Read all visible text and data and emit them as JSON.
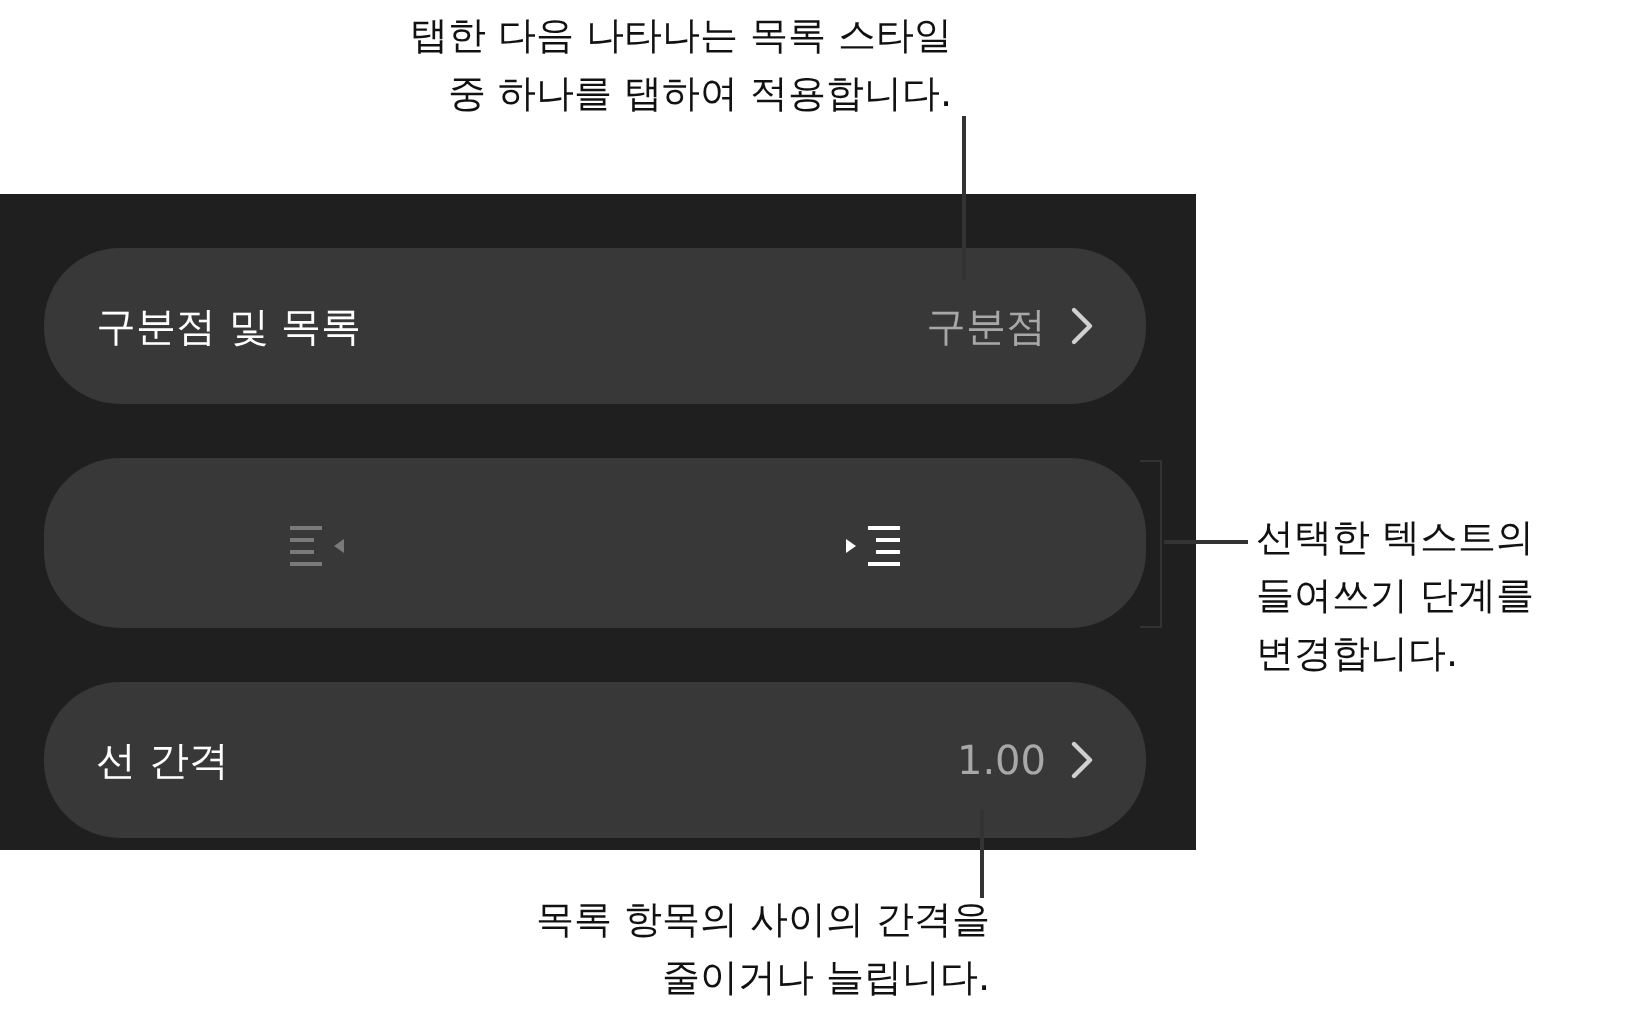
{
  "callouts": [
    {
      "lines": [
        "탭한 다음 나타나는 목록 스타일",
        "중 하나를 탭하여 적용합니다."
      ]
    },
    {
      "lines": [
        "선택한 텍스트의",
        "들여쓰기 단계를",
        "변경합니다."
      ]
    },
    {
      "lines": [
        "목록 항목의 사이의 간격을",
        "줄이거나 늘립니다."
      ]
    }
  ],
  "rows": [
    {
      "kind": "disclosure",
      "label": "구분점 및 목록",
      "value": "구분점"
    },
    {
      "kind": "indent",
      "buttons": [
        {
          "kind": "outdent",
          "disabled": true
        },
        {
          "kind": "indent",
          "disabled": false
        }
      ]
    },
    {
      "kind": "disclosure",
      "label": "선 간격",
      "value": "1.00"
    }
  ]
}
